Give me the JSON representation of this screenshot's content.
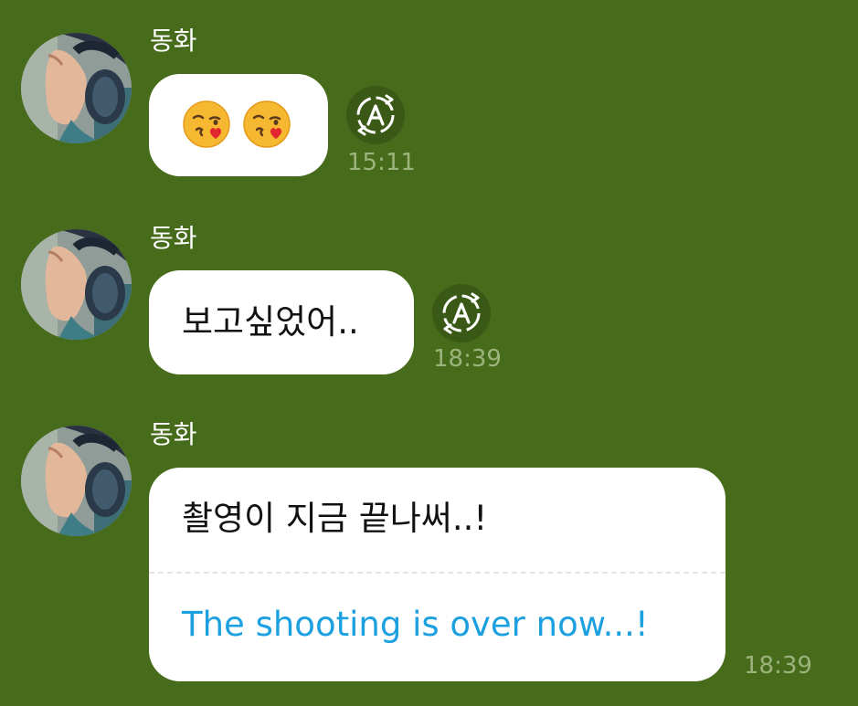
{
  "messages": [
    {
      "sender": "동화",
      "kind": "emoji",
      "emojis": [
        "kissing-face-with-heart-emoji",
        "kissing-face-with-heart-emoji"
      ],
      "time": "15:11",
      "translate_icon": "translate-icon"
    },
    {
      "sender": "동화",
      "kind": "text",
      "text": "보고싶었어..",
      "time": "18:39",
      "translate_icon": "translate-icon"
    },
    {
      "sender": "동화",
      "kind": "translated",
      "text": "촬영이 지금 끝나써..!",
      "translation": "The shooting is over now...!",
      "time": "18:39"
    }
  ],
  "colors": {
    "background": "#466b1b",
    "bubble": "#ffffff",
    "translation_text": "#1ca0e0",
    "time_text": "#9cb47b"
  }
}
